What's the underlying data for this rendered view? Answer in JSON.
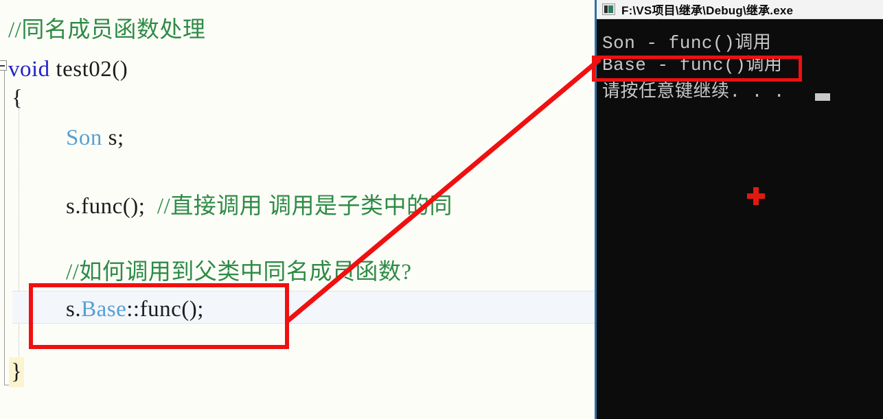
{
  "editor": {
    "name": "visual-studio-code-editor",
    "background": "#fdfdf8",
    "current_line_background": "#f3f6fb",
    "brace_highlight_background": "#fbf4d0",
    "colors": {
      "comment": "#2e8b45",
      "keyword": "#2222cc",
      "type": "#56a0d3",
      "plain": "#1c1c1c"
    },
    "lines": [
      {
        "id": "comment-title",
        "text": "//同名成员函数处理",
        "kind": "comment"
      },
      {
        "id": "func-signature-keyword",
        "text": "void",
        "kind": "keyword"
      },
      {
        "id": "func-signature-name",
        "text": " test02()",
        "kind": "plain"
      },
      {
        "id": "open-brace",
        "text": "{",
        "kind": "plain"
      },
      {
        "id": "decl-type",
        "text": "Son",
        "kind": "type"
      },
      {
        "id": "decl-var",
        "text": " s;",
        "kind": "plain"
      },
      {
        "id": "call-direct-code",
        "text": "s.func();  ",
        "kind": "plain"
      },
      {
        "id": "call-direct-comment",
        "text": "//直接调用 调用是子类中的同",
        "kind": "comment"
      },
      {
        "id": "question-comment",
        "text": "//如何调用到父类中同名成员函数?",
        "kind": "comment"
      },
      {
        "id": "scope-call-prefix",
        "text": "s.",
        "kind": "plain"
      },
      {
        "id": "scope-call-base",
        "text": "Base",
        "kind": "type"
      },
      {
        "id": "scope-call-suffix",
        "text": "::func();",
        "kind": "plain"
      },
      {
        "id": "close-brace",
        "text": "}",
        "kind": "plain"
      }
    ],
    "fold_indicator": "collapse-minus-box"
  },
  "console": {
    "name": "debug-console-window",
    "title": "F:\\VS项目\\继承\\Debug\\继承.exe",
    "icon": "console-window-icon",
    "background": "#0c0c0c",
    "text_color": "#c8c8c8",
    "output": [
      "Son - func()调用",
      "Base - func()调用",
      "请按任意键继续. . ."
    ],
    "cursor": "block-cursor",
    "marker": "red-plus-marker"
  },
  "annotations": {
    "color": "#ef1010",
    "code_highlight_box": {
      "name": "highlight-box-scope-resolution-call",
      "target": "s.Base::func();"
    },
    "console_highlight_box": {
      "name": "highlight-box-base-output",
      "target": "Base - func()调用"
    },
    "arrow": {
      "name": "connector-arrow",
      "from": "s.Base::func();",
      "to": "Base - func()调用"
    }
  }
}
